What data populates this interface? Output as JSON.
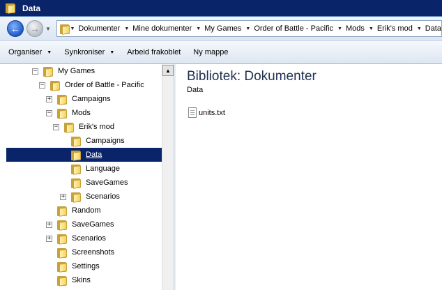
{
  "window": {
    "title": "Data",
    "title_icon": "folder-icon"
  },
  "address": {
    "crumbs": [
      "Dokumenter",
      "Mine dokumenter",
      "My Games",
      "Order of Battle - Pacific",
      "Mods",
      "Erik's mod",
      "Data"
    ]
  },
  "toolbar": {
    "organize": "Organiser",
    "sync": "Synkroniser",
    "offline": "Arbeid frakoblet",
    "new_folder": "Ny mappe"
  },
  "tree": {
    "items": [
      {
        "label": "My Games",
        "expander": "−",
        "level": 0
      },
      {
        "label": "Order of Battle - Pacific",
        "expander": "−",
        "level": 1
      },
      {
        "label": "Campaigns",
        "expander": "+",
        "level": 2
      },
      {
        "label": "Mods",
        "expander": "−",
        "level": 2
      },
      {
        "label": "Erik's mod",
        "expander": "−",
        "level": 3
      },
      {
        "label": "Campaigns",
        "expander": "",
        "level": 4
      },
      {
        "label": "Data",
        "expander": "",
        "level": 4,
        "selected": true
      },
      {
        "label": "Language",
        "expander": "",
        "level": 4
      },
      {
        "label": "SaveGames",
        "expander": "",
        "level": 4
      },
      {
        "label": "Scenarios",
        "expander": "+",
        "level": 4
      },
      {
        "label": "Random",
        "expander": "",
        "level": 2
      },
      {
        "label": "SaveGames",
        "expander": "+",
        "level": 2
      },
      {
        "label": "Scenarios",
        "expander": "+",
        "level": 2
      },
      {
        "label": "Screenshots",
        "expander": "",
        "level": 2
      },
      {
        "label": "Settings",
        "expander": "",
        "level": 2
      },
      {
        "label": "Skins",
        "expander": "",
        "level": 2
      }
    ]
  },
  "content": {
    "library_title": "Bibliotek: Dokumenter",
    "subtitle": "Data",
    "files": [
      {
        "name": "units.txt",
        "icon": "text-file-icon"
      }
    ]
  }
}
